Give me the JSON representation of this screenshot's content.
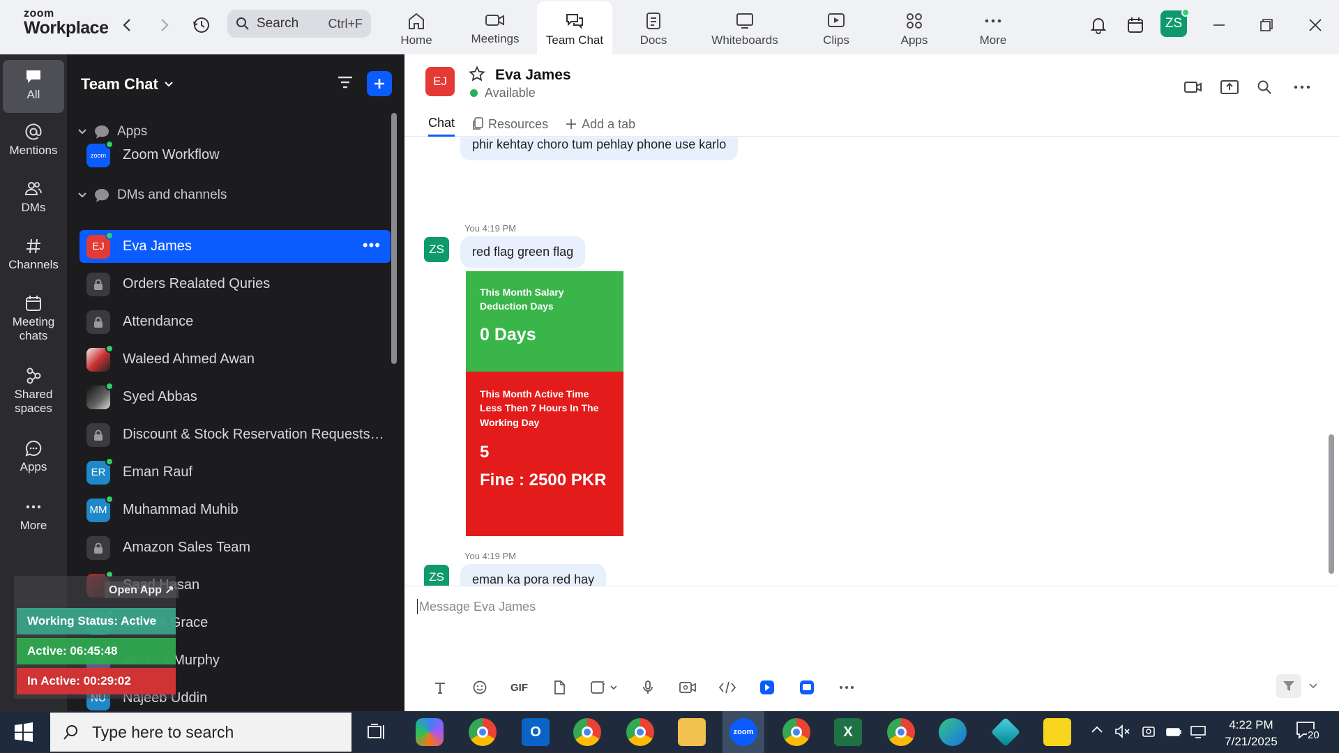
{
  "app": {
    "logo_top": "zoom",
    "logo_bottom": "Workplace"
  },
  "topbar": {
    "search_label": "Search",
    "search_shortcut": "Ctrl+F",
    "tabs": [
      {
        "label": "Home",
        "icon": "home-icon"
      },
      {
        "label": "Meetings",
        "icon": "video-camera-icon"
      },
      {
        "label": "Team Chat",
        "icon": "chat-bubbles-icon",
        "active": true
      },
      {
        "label": "Docs",
        "icon": "document-icon"
      },
      {
        "label": "Whiteboards",
        "icon": "whiteboard-icon"
      },
      {
        "label": "Clips",
        "icon": "clips-icon"
      },
      {
        "label": "Apps",
        "icon": "apps-icon"
      },
      {
        "label": "More",
        "icon": "more-dots-icon"
      }
    ],
    "user_initials": "ZS"
  },
  "rail": [
    {
      "label": "All",
      "icon": "chat-icon",
      "active": true
    },
    {
      "label": "Mentions",
      "icon": "at-icon"
    },
    {
      "label": "DMs",
      "icon": "people-icon"
    },
    {
      "label": "Channels",
      "icon": "hash-icon"
    },
    {
      "label": "Meeting chats",
      "icon": "calendar-icon"
    },
    {
      "label": "Shared spaces",
      "icon": "shared-spaces-icon"
    },
    {
      "label": "Apps",
      "icon": "apps-chat-icon"
    },
    {
      "label": "More",
      "icon": "more-dots-icon"
    }
  ],
  "sidebar": {
    "title": "Team Chat",
    "groups": {
      "apps": "Apps",
      "dms": "DMs and channels"
    },
    "app_item": {
      "label": "Zoom Workflow",
      "badge": "zoom"
    },
    "items": [
      {
        "label": "Eva James",
        "initials": "EJ",
        "type": "avatar",
        "color": "#e53935",
        "online": true,
        "selected": true
      },
      {
        "label": "Orders Realated Quries",
        "type": "lock"
      },
      {
        "label": "Attendance",
        "type": "lock"
      },
      {
        "label": "Waleed Ahmed Awan",
        "type": "photo",
        "online": true
      },
      {
        "label": "Syed Abbas",
        "type": "photo",
        "online": true
      },
      {
        "label": "Discount & Stock Reservation Requests O...",
        "type": "lock"
      },
      {
        "label": "Eman Rauf",
        "initials": "ER",
        "type": "avatar",
        "color": "#1e88c8",
        "online": true
      },
      {
        "label": "Muhammad Muhib",
        "initials": "MM",
        "type": "avatar",
        "color": "#1e88c8",
        "online": true
      },
      {
        "label": "Amazon Sales Team",
        "type": "lock"
      },
      {
        "label": "Saad Hasan",
        "type": "photo",
        "online": true
      },
      {
        "label": "Sophia Grace",
        "initials": "SG",
        "type": "avatar",
        "color": "#0e9a6c",
        "online": true
      },
      {
        "label": "Jessica Murphy",
        "initials": "JM",
        "type": "avatar",
        "color": "#8e6bd6",
        "online": false
      },
      {
        "label": "Najeeb Uddin",
        "initials": "NU",
        "type": "avatar",
        "color": "#1e88c8",
        "online": false
      }
    ]
  },
  "overlay": {
    "open_app": "Open App ↗",
    "working_status": "Working Status: Active",
    "active": "Active: 06:45:48",
    "inactive": "In Active: 00:29:02",
    "colors": {
      "status": "#3aa88c",
      "active": "#2fa84f",
      "inactive": "#d93434"
    }
  },
  "chat": {
    "contact_initials": "EJ",
    "contact_name": "Eva James",
    "status": "Available",
    "tabs": {
      "chat": "Chat",
      "resources": "Resources",
      "add": "Add a tab"
    },
    "messages": {
      "prev_text": "phir kehtay choro tum pehlay phone use karlo",
      "m1_author": "You",
      "m1_time": "4:19 PM",
      "m1_text": "red flag green flag",
      "m2_author": "You",
      "m2_time": "4:19 PM",
      "m2_text": "eman ka pora red hay",
      "avatar": "ZS"
    },
    "card": {
      "green_title": "This Month Salary Deduction Days",
      "green_value": "0 Days",
      "red_title": "This Month Active Time Less Then 7 Hours In The Working Day",
      "red_count": "5",
      "red_fine": "Fine : 2500 PKR"
    },
    "compose_placeholder": "Message Eva James",
    "gif_label": "GIF"
  },
  "taskbar": {
    "search_placeholder": "Type here to search",
    "time": "4:22 PM",
    "date": "7/21/2025",
    "notification_count": "20"
  }
}
